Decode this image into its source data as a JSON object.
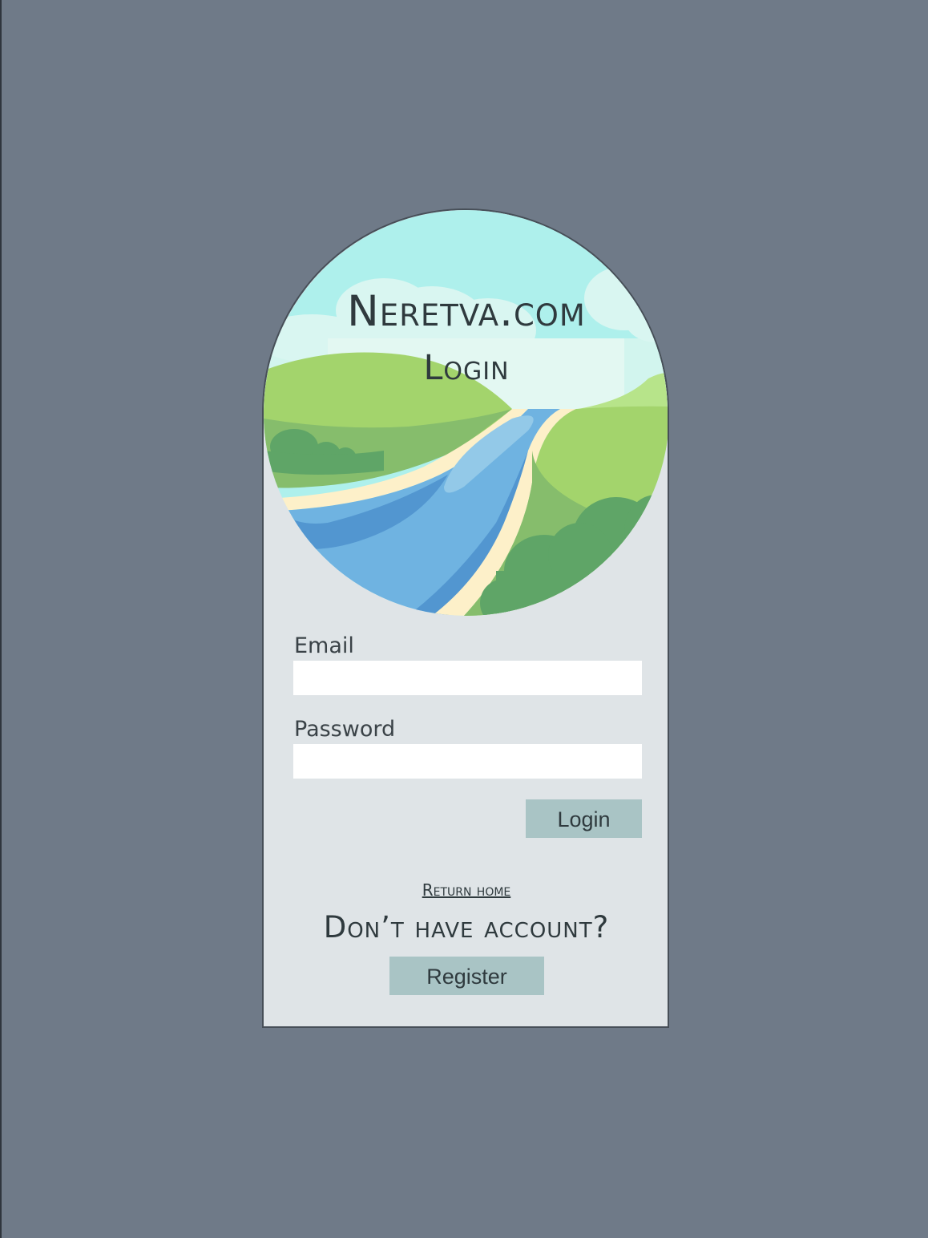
{
  "brand": {
    "site_name": "Neretva.com",
    "page_heading": "Login"
  },
  "form": {
    "email_label": "Email",
    "email_value": "",
    "password_label": "Password",
    "password_value": "",
    "login_button": "Login"
  },
  "footer": {
    "return_home_link": "Return home",
    "no_account_text": "Don’t have account?",
    "register_button": "Register"
  },
  "colors": {
    "page_background": "#6f7a88",
    "card_background": "#dfe4e7",
    "button_background": "#a9c4c5",
    "text": "#2f3a3e"
  },
  "illustration": {
    "icon": "river-landscape-illustration"
  }
}
